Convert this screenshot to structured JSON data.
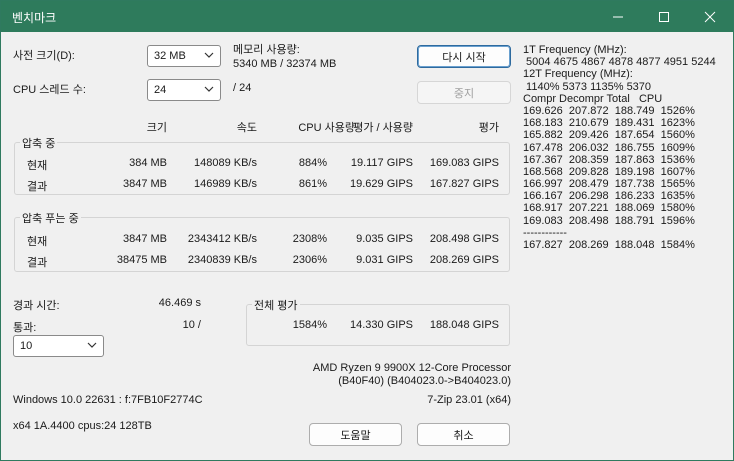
{
  "window": {
    "title": "벤치마크",
    "minimize_icon": "minimize-icon",
    "maximize_icon": "maximize-icon",
    "close_icon": "close-icon"
  },
  "settings": {
    "dict_label": "사전 크기(D):",
    "dict_value": "32 MB",
    "threads_label": "CPU 스레드 수:",
    "threads_value": "24",
    "threads_total": "/ 24",
    "memory_label": "메모리 사용량:",
    "memory_value": "5340 MB / 32374 MB"
  },
  "buttons": {
    "restart": "다시 시작",
    "stop": "중지",
    "help": "도움말",
    "cancel": "취소"
  },
  "table": {
    "headers": {
      "size": "크기",
      "speed": "속도",
      "cpu_usage": "CPU 사용량",
      "rating_usage": "평가 / 사용량",
      "rating": "평가"
    },
    "compress": {
      "title": "압축 중",
      "rows": [
        {
          "label": "현재",
          "size": "384 MB",
          "speed": "148089 KB/s",
          "cpu": "884%",
          "rating_usage": "19.117 GIPS",
          "rating": "169.083 GIPS"
        },
        {
          "label": "결과",
          "size": "3847 MB",
          "speed": "146989 KB/s",
          "cpu": "861%",
          "rating_usage": "19.629 GIPS",
          "rating": "167.827 GIPS"
        }
      ]
    },
    "decompress": {
      "title": "압축 푸는 중",
      "rows": [
        {
          "label": "현재",
          "size": "3847 MB",
          "speed": "2343412 KB/s",
          "cpu": "2308%",
          "rating_usage": "9.035 GIPS",
          "rating": "208.498 GIPS"
        },
        {
          "label": "결과",
          "size": "38475 MB",
          "speed": "2340839 KB/s",
          "cpu": "2306%",
          "rating_usage": "9.031 GIPS",
          "rating": "208.269 GIPS"
        }
      ]
    }
  },
  "elapsed": {
    "label": "경과 시간:",
    "value": "46.469 s",
    "passes_label": "통과:",
    "passes_value": "10 /",
    "passes_select": "10"
  },
  "total": {
    "title": "전체 평가",
    "cpu": "1584%",
    "rating_usage": "14.330 GIPS",
    "rating": "188.048 GIPS"
  },
  "system": {
    "cpu_name": "AMD Ryzen 9 9900X 12-Core Processor",
    "cpu_id": "(B40F40) (B404023.0->B404023.0)",
    "os": "Windows 10.0 22631 : f:7FB10F2774C",
    "version": "7-Zip 23.01 (x64)",
    "arch": "x64 1A.4400 cpus:24 128TB"
  },
  "log": [
    "1T Frequency (MHz):",
    " 5004 4675 4867 4878 4877 4951 5244",
    "12T Frequency (MHz):",
    " 1140% 5373 1135% 5370",
    "Compr Decompr Total   CPU",
    "169.626  207.872  188.749  1526%",
    "168.183  210.679  189.431  1623%",
    "165.882  209.426  187.654  1560%",
    "167.478  206.032  186.755  1609%",
    "167.367  208.359  187.863  1536%",
    "168.568  209.828  189.198  1607%",
    "166.997  208.479  187.738  1565%",
    "166.167  206.298  186.233  1635%",
    "168.917  207.221  188.069  1580%",
    "169.083  208.498  188.791  1596%",
    "------------",
    "167.827  208.269  188.048  1584%"
  ]
}
